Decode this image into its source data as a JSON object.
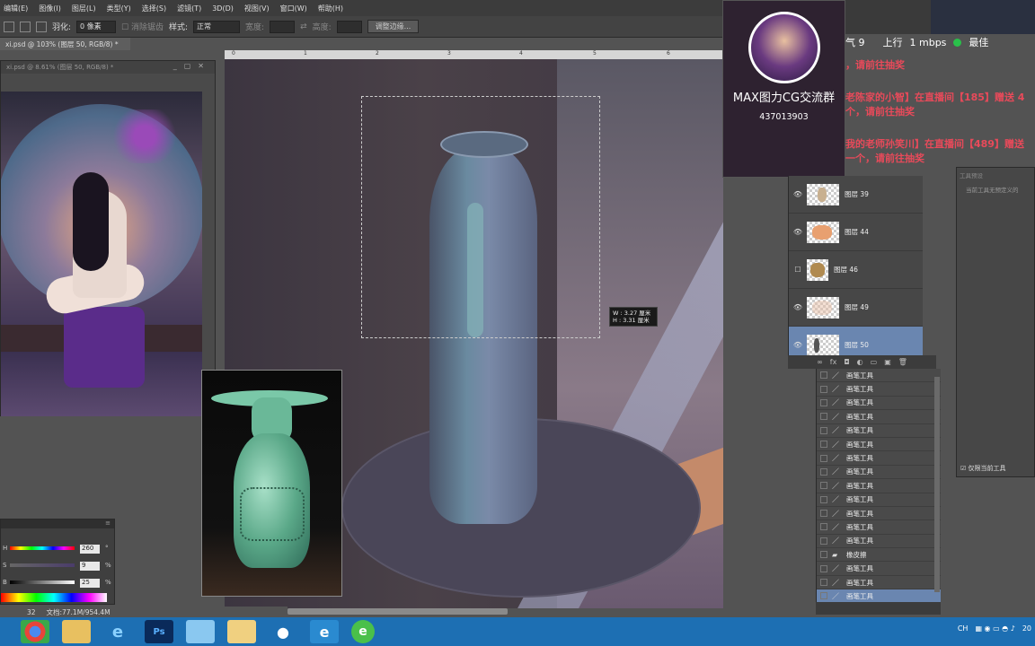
{
  "menu": [
    "编辑(E)",
    "图像(I)",
    "图层(L)",
    "类型(Y)",
    "选择(S)",
    "滤镜(T)",
    "3D(D)",
    "视图(V)",
    "窗口(W)",
    "帮助(H)"
  ],
  "options": {
    "feather_label": "羽化:",
    "feather_value": "0 像素",
    "antialias_label": "消除锯齿",
    "style_label": "样式:",
    "style_value": "正常",
    "width_label": "宽度:",
    "height_label": "高度:",
    "refine_button": "调整边缘..."
  },
  "doc_tab": "xi.psd @ 103% (图层 50, RGB/8) *",
  "second_window_title": "xi.psd @ 8.61% (图层 50, RGB/8) *",
  "ruler_ticks": [
    "0",
    "1",
    "2",
    "3",
    "4",
    "5",
    "6"
  ],
  "transform_tooltip": {
    "w": "W : 3.27 厘米",
    "h": "H : 3.31 厘米"
  },
  "color_panel": {
    "rows": [
      {
        "label": "H",
        "value": "260",
        "unit": "°"
      },
      {
        "label": "S",
        "value": "9",
        "unit": "%"
      },
      {
        "label": "B",
        "value": "25",
        "unit": "%"
      }
    ]
  },
  "status": {
    "zoom": "32",
    "doc": "文档:77.1M/954.4M"
  },
  "live_overlay": {
    "group_name": "MAX图力CG交流群",
    "group_number": "437013903"
  },
  "net": {
    "partial": "气 9",
    "upload_label": "上行",
    "speed": "1 mbps",
    "quality": "最佳"
  },
  "chat_lines": [
    "，请前往抽奖",
    "老陈家的小智】在直播间【185】赠送 4",
    "个，请前往抽奖",
    "我的老师孙笑川】在直播间【489】赠送",
    "一个，请前往抽奖"
  ],
  "layers": [
    {
      "name": "图层 39",
      "visible": true,
      "selected": false
    },
    {
      "name": "图层 44",
      "visible": true,
      "selected": false
    },
    {
      "name": "图层 46",
      "visible": false,
      "selected": false
    },
    {
      "name": "图层 49",
      "visible": true,
      "selected": false
    },
    {
      "name": "图层 50",
      "visible": true,
      "selected": true
    }
  ],
  "history_items": [
    "画笔工具",
    "画笔工具",
    "画笔工具",
    "画笔工具",
    "画笔工具",
    "画笔工具",
    "画笔工具",
    "画笔工具",
    "画笔工具",
    "画笔工具",
    "画笔工具",
    "画笔工具",
    "画笔工具",
    "橡皮擦",
    "画笔工具",
    "画笔工具",
    "画笔工具"
  ],
  "right_panel": {
    "title": "工具预设",
    "empty": "当前工具无预定义的",
    "checkbox": "仅限当前工具"
  },
  "taskbar": {
    "apps": [
      "Chrome",
      "Explorer",
      "IE",
      "PS",
      "Media",
      "Notes",
      "QQ",
      "IE2",
      "Browser"
    ],
    "ime": "CH",
    "clock": "20"
  },
  "colors": {
    "accent": "#6a86b0",
    "chat": "#e84a5a",
    "taskbar": "#1d6fb3"
  }
}
